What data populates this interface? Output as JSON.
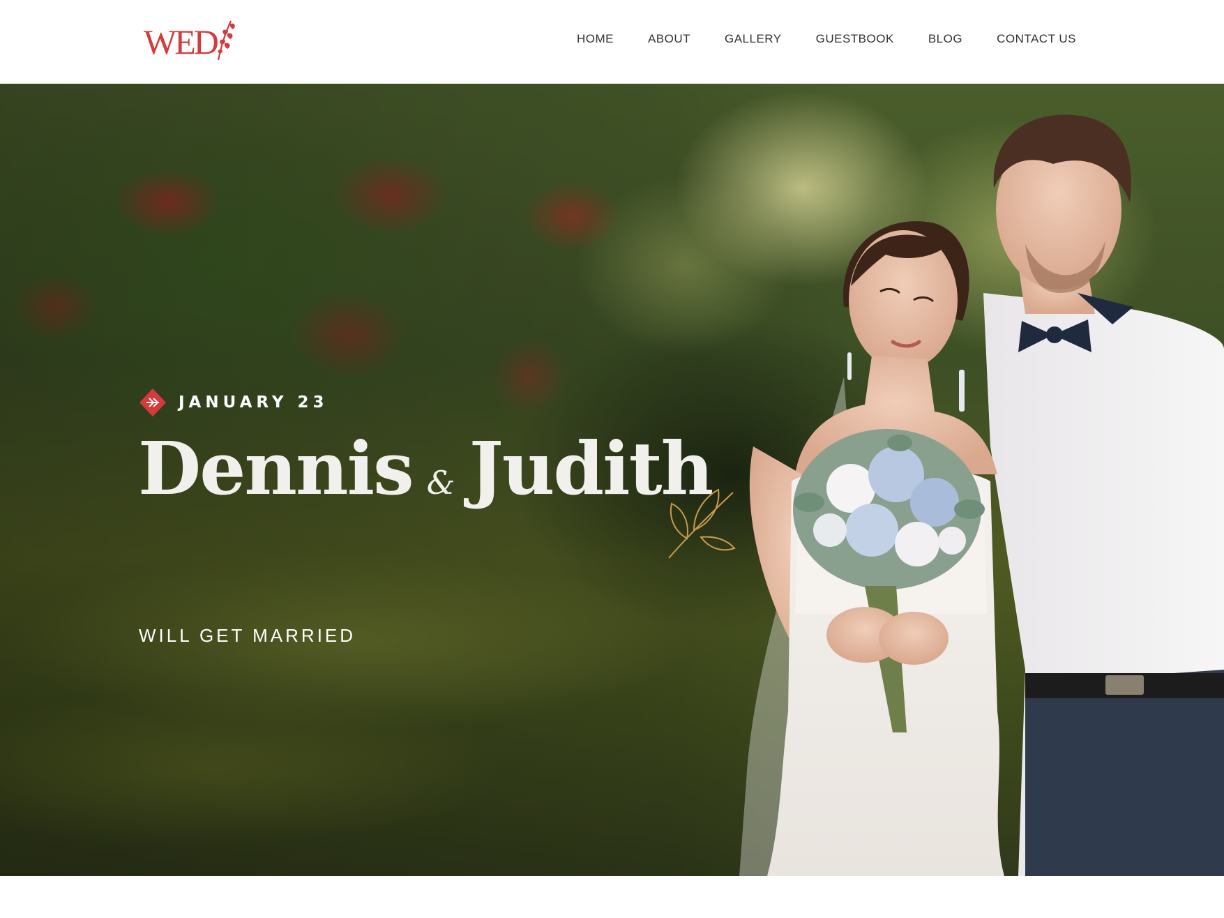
{
  "header": {
    "logo_text": "WED",
    "nav": [
      {
        "label": "HOME"
      },
      {
        "label": "ABOUT"
      },
      {
        "label": "GALLERY"
      },
      {
        "label": "GUESTBOOK"
      },
      {
        "label": "BLOG"
      },
      {
        "label": "CONTACT US"
      }
    ]
  },
  "hero": {
    "date": "JANUARY 23",
    "name_left": "Dennis",
    "ampersand": "&",
    "name_right": "Judith",
    "subtitle": "WILL GET MARRIED"
  },
  "icons": {
    "logo_leaf": "wheat-leaf-icon",
    "date_badge": "red-leaf-badge-icon",
    "title_ornament": "gold-leaf-ornament-icon"
  },
  "colors": {
    "brand_red": "#d63a3a",
    "nav_text": "#333333",
    "hero_text": "#ffffff",
    "ornament_gold": "#c99a4c"
  }
}
